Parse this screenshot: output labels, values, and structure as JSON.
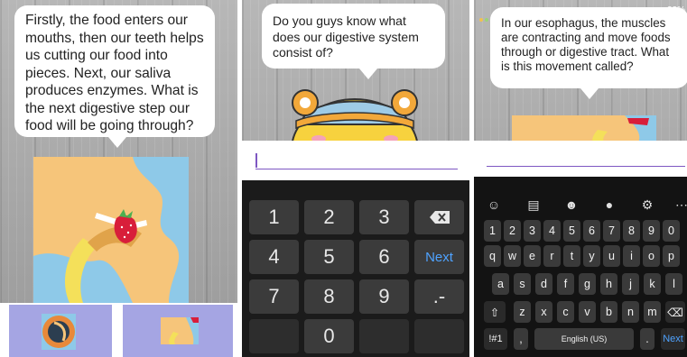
{
  "panel1": {
    "question": "Firstly, the food enters our mouths, then our teeth helps us cutting our food into pieces. Next, our saliva produces enzymes. What is the next digestive step our food will be going through?"
  },
  "panel2": {
    "question": "Do you guys know what does our digestive system consist of?",
    "numpad": {
      "keys": [
        "1",
        "2",
        "3",
        "4",
        "5",
        "6",
        "7",
        "8",
        "9",
        "0"
      ],
      "next_label": "Next",
      "symbol_label": ".-"
    }
  },
  "panel3": {
    "question": "In our esophagus, the muscles are contracting and move foods through or digestive tract. What is this movement called?",
    "status_battery": "33%",
    "keyboard": {
      "number_row": [
        "1",
        "2",
        "3",
        "4",
        "5",
        "6",
        "7",
        "8",
        "9",
        "0"
      ],
      "row1": [
        "q",
        "w",
        "e",
        "r",
        "t",
        "y",
        "u",
        "i",
        "o",
        "p"
      ],
      "row2": [
        "a",
        "s",
        "d",
        "f",
        "g",
        "h",
        "j",
        "k",
        "l"
      ],
      "row3": [
        "z",
        "x",
        "c",
        "v",
        "b",
        "n",
        "m"
      ],
      "symbols_label": "!#1",
      "comma_label": ",",
      "space_label": "English (US)",
      "period_label": ".",
      "next_label": "Next"
    }
  },
  "colors": {
    "accent_purple": "#7e57c2",
    "next_blue": "#4fa3ff",
    "card_orange": "#f6c57a",
    "card_blue": "#8ec9e8",
    "choice_lavender": "#a5a5e3"
  }
}
